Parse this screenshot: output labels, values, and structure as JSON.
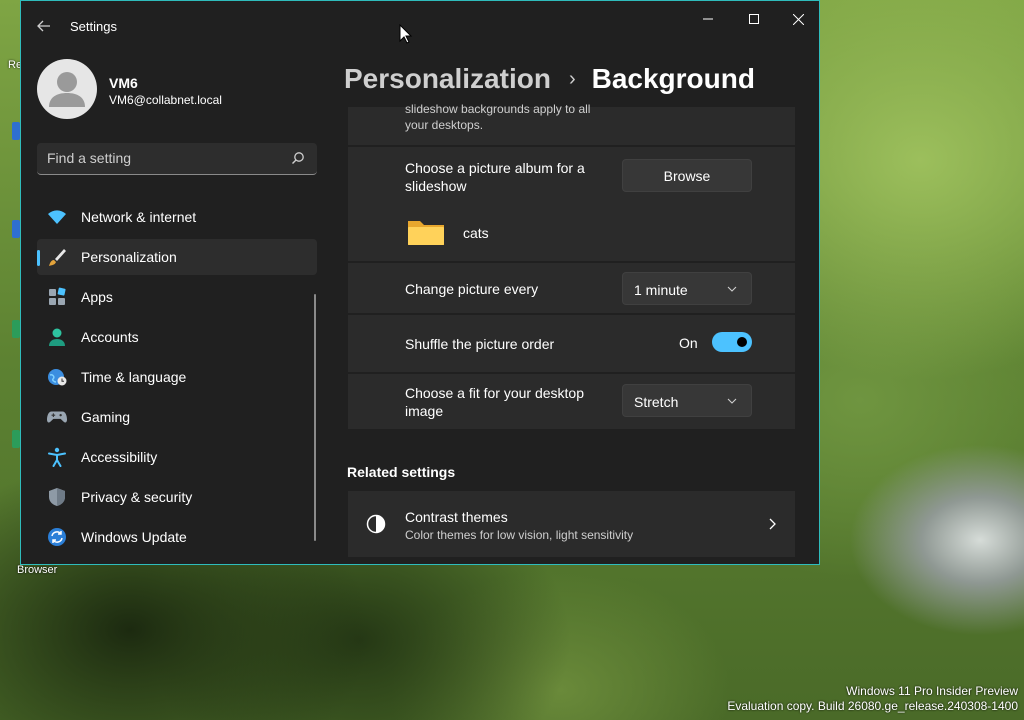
{
  "desktop": {
    "label_browser": "Browser"
  },
  "watermark": {
    "line1": "Windows 11 Pro Insider Preview",
    "line2": "Evaluation copy. Build 26080.ge_release.240308-1400"
  },
  "window": {
    "title": "Settings"
  },
  "user": {
    "name": "VM6",
    "email": "VM6@collabnet.local"
  },
  "search": {
    "placeholder": "Find a setting"
  },
  "nav": {
    "items": [
      {
        "label": "Network & internet"
      },
      {
        "label": "Personalization"
      },
      {
        "label": "Apps"
      },
      {
        "label": "Accounts"
      },
      {
        "label": "Time & language"
      },
      {
        "label": "Gaming"
      },
      {
        "label": "Accessibility"
      },
      {
        "label": "Privacy & security"
      },
      {
        "label": "Windows Update"
      }
    ]
  },
  "breadcrumb": {
    "parent": "Personalization",
    "separator": "›",
    "current": "Background"
  },
  "background": {
    "partial_text_line1": "slideshow backgrounds apply to all",
    "partial_text_line2": "your desktops.",
    "album_label_line1": "Choose a picture album for a",
    "album_label_line2": "slideshow",
    "browse_label": "Browse",
    "album_folder": "cats",
    "change_every_label": "Change picture every",
    "change_every_value": "1 minute",
    "shuffle_label": "Shuffle the picture order",
    "shuffle_state": "On",
    "fit_label_line1": "Choose a fit for your desktop",
    "fit_label_line2": "image",
    "fit_value": "Stretch"
  },
  "related": {
    "title": "Related settings",
    "contrast_title": "Contrast themes",
    "contrast_desc": "Color themes for low vision, light sensitivity"
  },
  "colors": {
    "accent": "#4cc2ff",
    "window_border": "#2fbcbc",
    "window_bg": "#202020",
    "card_bg": "#2b2b2b"
  }
}
